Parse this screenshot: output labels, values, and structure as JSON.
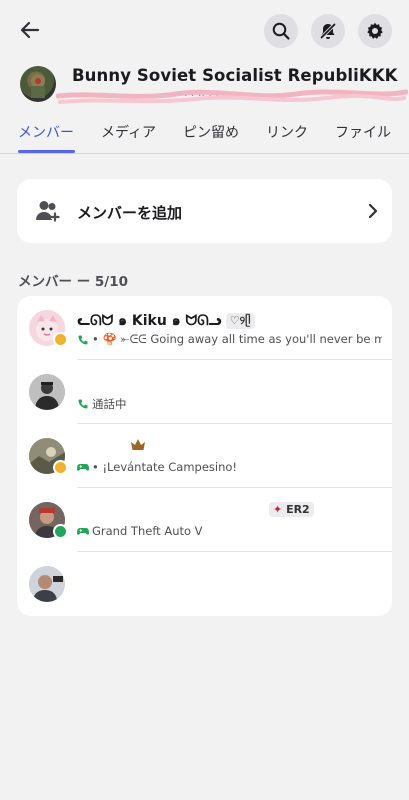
{
  "header": {
    "group_name": "Bunny Soviet Socialist RepubliKKK",
    "group_subtitle": "· ·  · ··  · ·· ·  ·· ·  · · ·· ·  · · · ··  · · · ·  ·· ·"
  },
  "tabs": [
    {
      "label": "メンバー"
    },
    {
      "label": "メディア"
    },
    {
      "label": "ピン留め"
    },
    {
      "label": "リンク"
    },
    {
      "label": "ファイル"
    }
  ],
  "add_member": {
    "label": "メンバーを追加"
  },
  "members_section": {
    "title": "メンバー ー 5/10"
  },
  "members": [
    {
      "name": "ᓚᘏᗢ ๑ Kiku ๑ ᗢᘏᓗ",
      "tag": "♡୨ᥫ",
      "activity": "• 🍄 ⤜ᕮᕮ Going away all time as you'll never be mine",
      "status": "idle"
    },
    {
      "name": "",
      "tag": "",
      "activity": "通話中",
      "status": "none"
    },
    {
      "name": "",
      "tag": "",
      "activity": "• ¡Levántate Campesino!",
      "status": "idle"
    },
    {
      "name": "",
      "tag": "ER2",
      "activity": "Grand Theft Auto V",
      "status": "online"
    },
    {
      "name": "",
      "tag": "",
      "activity": "",
      "status": "none"
    }
  ],
  "colors": {
    "accent": "#5865f2",
    "active_tab": "#3d55c8",
    "online": "#23a55a",
    "idle": "#f0b232",
    "background": "#f2f2f3",
    "card": "#ffffff"
  },
  "icons": [
    "back-arrow-icon",
    "search-icon",
    "notifications-muted-icon",
    "gear-icon",
    "add-member-icon",
    "chevron-right-icon",
    "phone-icon",
    "gamepad-icon",
    "crown-icon"
  ]
}
